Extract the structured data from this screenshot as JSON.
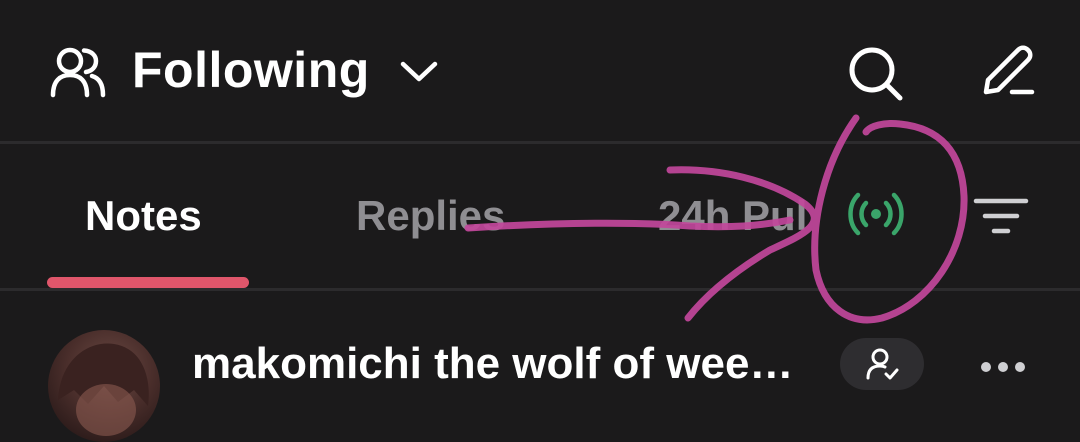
{
  "header": {
    "title": "Following",
    "icons": {
      "people": "people-icon",
      "dropdown": "chevron-down-icon",
      "search": "search-icon",
      "compose": "pencil-icon"
    }
  },
  "tabs": {
    "items": [
      {
        "label": "Notes",
        "active": true
      },
      {
        "label": "Replies",
        "active": false
      },
      {
        "label": "24h Pul",
        "active": false
      }
    ],
    "live_icon": "live-broadcast-icon",
    "filter_icon": "filter-icon"
  },
  "note": {
    "author": "makomichi the wolf of wee…",
    "follow_icon": "user-check-icon",
    "more_icon": "more-icon"
  },
  "colors": {
    "background": "#1b1a1b",
    "accent": "#e0566b",
    "live": "#3aa56a",
    "annotation": "#c2479b"
  }
}
